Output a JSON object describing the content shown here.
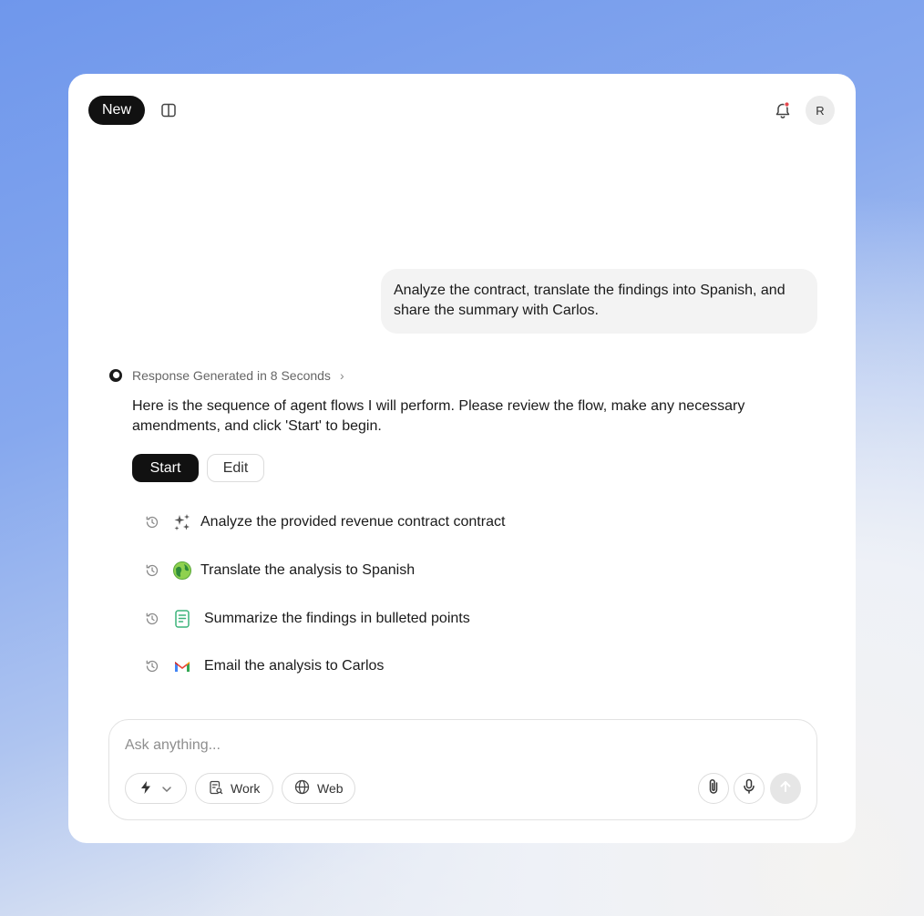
{
  "header": {
    "new_label": "New",
    "avatar_initial": "R"
  },
  "conversation": {
    "user_message": "Analyze the contract, translate the findings into Spanish, and share the summary with Carlos.",
    "response_meta": "Response Generated in 8 Seconds",
    "response_text": "Here is the sequence of agent flows I will perform. Please review the flow, make any necessary amendments, and click 'Start' to begin.",
    "start_label": "Start",
    "edit_label": "Edit",
    "steps": [
      {
        "label": "Analyze the provided revenue contract contract",
        "icon": "sparkles-icon"
      },
      {
        "label": "Translate the analysis to Spanish",
        "icon": "globe-translate-icon"
      },
      {
        "label": "Summarize the findings in bulleted points",
        "icon": "document-icon"
      },
      {
        "label": "Email the analysis to Carlos",
        "icon": "gmail-icon"
      }
    ]
  },
  "composer": {
    "placeholder": "Ask anything...",
    "work_label": "Work",
    "web_label": "Web"
  },
  "colors": {
    "accent_dark": "#111111",
    "notification_dot": "#e5484d",
    "doc_icon_green": "#3bb37a"
  }
}
